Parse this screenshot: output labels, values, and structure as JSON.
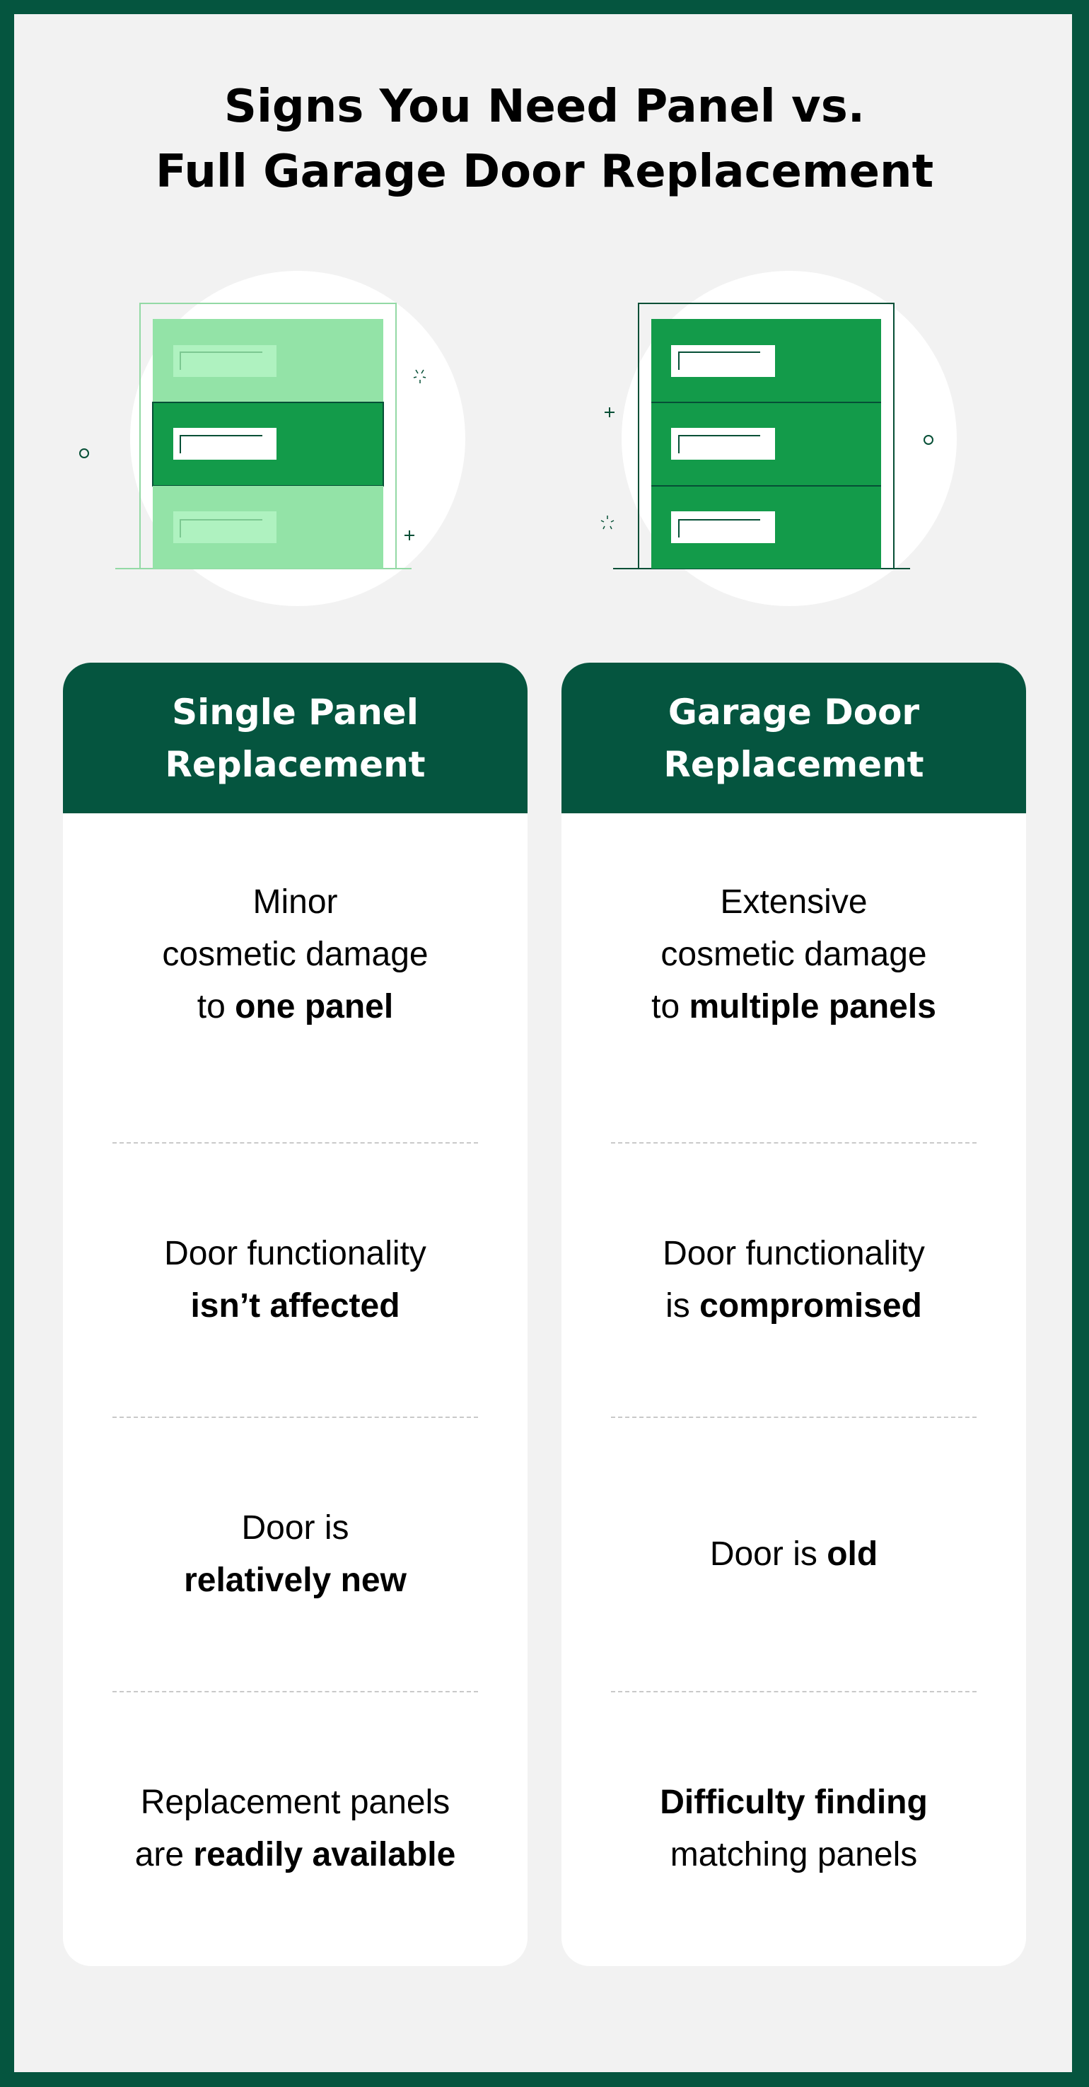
{
  "title": {
    "line1": "Signs You Need Panel vs.",
    "line2": "Full Garage Door Replacement"
  },
  "colors": {
    "brand_dark_green": "#05553f",
    "door_green": "#139b4a",
    "door_light_green": "#93e3a7",
    "window_light_green": "#aff2c0",
    "background": "#f2f2f2"
  },
  "illustrations": {
    "left": {
      "icon": "garage-door-single-panel-icon",
      "description": "Garage door with one highlighted panel"
    },
    "right": {
      "icon": "garage-door-full-icon",
      "description": "Fully replaced garage door"
    }
  },
  "columns": [
    {
      "header": {
        "line1": "Single Panel",
        "line2": "Replacement"
      },
      "rows": [
        {
          "lines": [
            [
              {
                "t": "Minor",
                "b": false
              }
            ],
            [
              {
                "t": "cosmetic damage",
                "b": false
              }
            ],
            [
              {
                "t": "to ",
                "b": false
              },
              {
                "t": "one panel",
                "b": true
              }
            ]
          ]
        },
        {
          "lines": [
            [
              {
                "t": "Door functionality",
                "b": false
              }
            ],
            [
              {
                "t": "isn’t affected",
                "b": true
              }
            ]
          ]
        },
        {
          "lines": [
            [
              {
                "t": "Door is",
                "b": false
              }
            ],
            [
              {
                "t": "relatively new",
                "b": true
              }
            ]
          ]
        },
        {
          "lines": [
            [
              {
                "t": "Replacement panels",
                "b": false
              }
            ],
            [
              {
                "t": "are ",
                "b": false
              },
              {
                "t": "readily available",
                "b": true
              }
            ]
          ]
        }
      ]
    },
    {
      "header": {
        "line1": "Garage Door",
        "line2": "Replacement"
      },
      "rows": [
        {
          "lines": [
            [
              {
                "t": "Extensive",
                "b": false
              }
            ],
            [
              {
                "t": "cosmetic damage",
                "b": false
              }
            ],
            [
              {
                "t": "to ",
                "b": false
              },
              {
                "t": "multiple panels",
                "b": true
              }
            ]
          ]
        },
        {
          "lines": [
            [
              {
                "t": "Door functionality",
                "b": false
              }
            ],
            [
              {
                "t": "is ",
                "b": false
              },
              {
                "t": "compromised",
                "b": true
              }
            ]
          ]
        },
        {
          "lines": [
            [
              {
                "t": "Door is ",
                "b": false
              },
              {
                "t": "old",
                "b": true
              }
            ]
          ]
        },
        {
          "lines": [
            [
              {
                "t": "Difficulty finding",
                "b": true
              }
            ],
            [
              {
                "t": "matching panels",
                "b": false
              }
            ]
          ]
        }
      ]
    }
  ]
}
